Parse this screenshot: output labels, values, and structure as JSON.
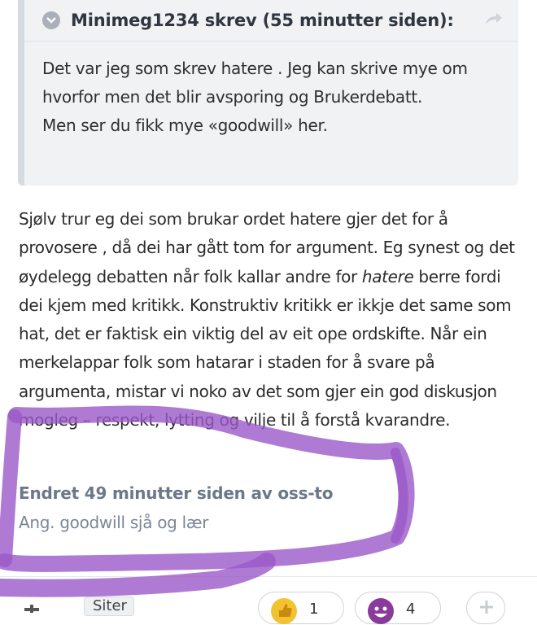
{
  "quote": {
    "author_line": "Minimeg1234 skrev (55 minutter siden):",
    "lines": [
      "Det var jeg som skrev hatere . Jeg kan skrive mye om",
      "hvorfor men det blir avsporing og Brukerdebatt.",
      "Men ser du fikk mye «goodwill» her."
    ]
  },
  "post": {
    "segments": {
      "a": "Sjølv trur eg dei som brukar ordet hatere gjer det for å provosere , då dei har gått tom for argument. Eg synest og det øydelegg  debatten når folk kallar andre for ",
      "emphasis": "hatere",
      "b": " berre fordi dei kjem med kritikk. Konstruktiv kritikk er ikkje det same som hat, det er faktisk ein viktig del av eit ope ordskifte. Når ein merkelappar folk som hatarar i staden for å svare på argumenta, mistar vi noko av det som gjer ein god diskusjon mogleg – respekt, lytting og vilje til å forstå kvarandre."
    }
  },
  "edit": {
    "edited_line": "Endret 49 minutter siden av oss-to",
    "reason": "Ang. goodwill sjå og lær"
  },
  "footer": {
    "cite_label": "Siter",
    "like_count": "1",
    "laugh_count": "4"
  },
  "colors": {
    "annotation": "#9b59c8",
    "quote_bg": "#f0f2f4",
    "edited_text": "#6b7888"
  }
}
